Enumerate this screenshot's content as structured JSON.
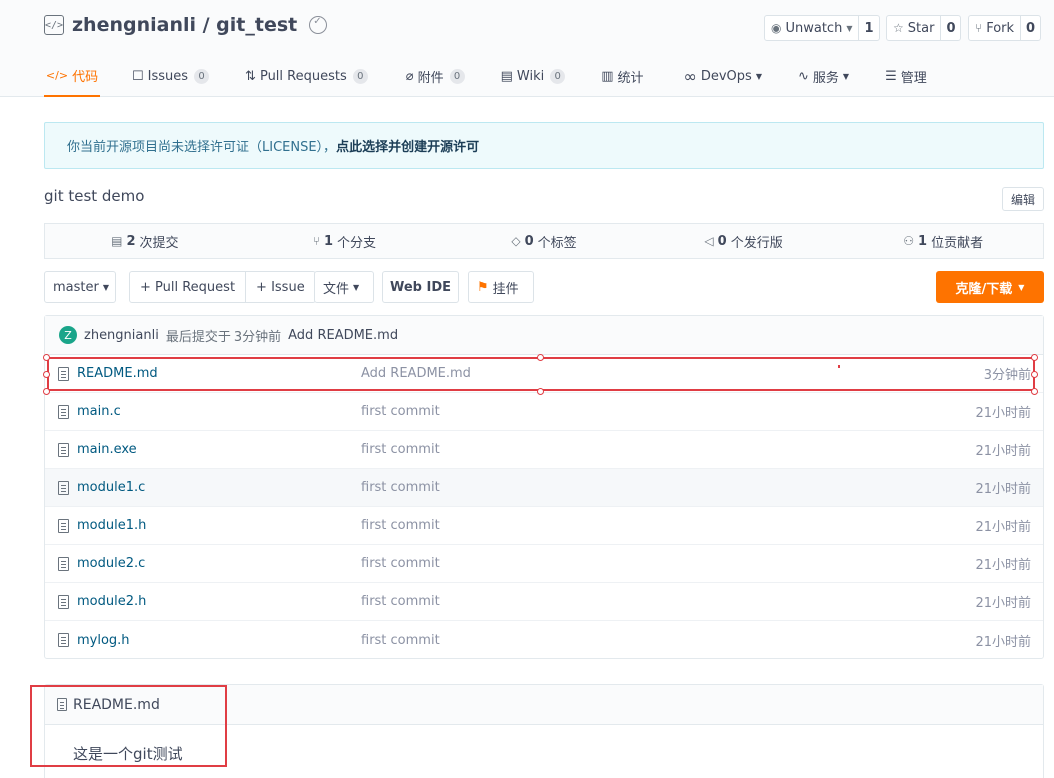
{
  "repo": {
    "title": "zhengnianli / git_test",
    "icon": "code-repo-icon",
    "badge_icon": "verified-badge-icon"
  },
  "social": {
    "watch_label": "Unwatch",
    "watch_count": "1",
    "star_label": "Star",
    "star_count": "0",
    "fork_label": "Fork",
    "fork_count": "0"
  },
  "tabs": [
    {
      "label": "代码",
      "icon": "</>",
      "count": "",
      "active": true
    },
    {
      "label": "Issues",
      "icon": "☐",
      "count": "0"
    },
    {
      "label": "Pull Requests",
      "icon": "⇅",
      "count": "0"
    },
    {
      "label": "附件",
      "icon": "⌀",
      "count": "0"
    },
    {
      "label": "Wiki",
      "icon": "▤",
      "count": "0"
    },
    {
      "label": "统计",
      "icon": "▥",
      "count": ""
    },
    {
      "label": "DevOps",
      "icon": "∞",
      "count": ""
    },
    {
      "label": "服务",
      "icon": "∿",
      "count": ""
    },
    {
      "label": "管理",
      "icon": "☰",
      "count": ""
    }
  ],
  "notice": {
    "text": "你当前开源项目尚未选择许可证（LICENSE），",
    "link": "点此选择并创建开源许可"
  },
  "description": "git test demo",
  "edit_label": "编辑",
  "stats": {
    "commits_num": "2",
    "commits_label": "次提交",
    "branches_num": "1",
    "branches_label": "个分支",
    "tags_num": "0",
    "tags_label": "个标签",
    "releases_num": "0",
    "releases_label": "个发行版",
    "contributors_num": "1",
    "contributors_label": "位贡献者"
  },
  "toolbar": {
    "branch": "master",
    "pull_request": "+ Pull Request",
    "issue": "+ Issue",
    "files": "文件",
    "web_ide": "Web IDE",
    "mount": "挂件",
    "clone": "克隆/下载"
  },
  "last_commit": {
    "avatar_letter": "Z",
    "author": "zhengnianli",
    "meta": "最后提交于",
    "time": "3分钟前",
    "message": "Add README.md"
  },
  "files": [
    {
      "name": "README.md",
      "message": "Add README.md",
      "time": "3分钟前"
    },
    {
      "name": "main.c",
      "message": "first commit",
      "time": "21小时前"
    },
    {
      "name": "main.exe",
      "message": "first commit",
      "time": "21小时前"
    },
    {
      "name": "module1.c",
      "message": "first commit",
      "time": "21小时前"
    },
    {
      "name": "module1.h",
      "message": "first commit",
      "time": "21小时前"
    },
    {
      "name": "module2.c",
      "message": "first commit",
      "time": "21小时前"
    },
    {
      "name": "module2.h",
      "message": "first commit",
      "time": "21小时前"
    },
    {
      "name": "mylog.h",
      "message": "first commit",
      "time": "21小时前"
    }
  ],
  "readme": {
    "title": "README.md",
    "content": "这是一个git测试"
  },
  "colors": {
    "accent": "#fe7300",
    "link": "#005980",
    "highlight": "#e03d44"
  }
}
